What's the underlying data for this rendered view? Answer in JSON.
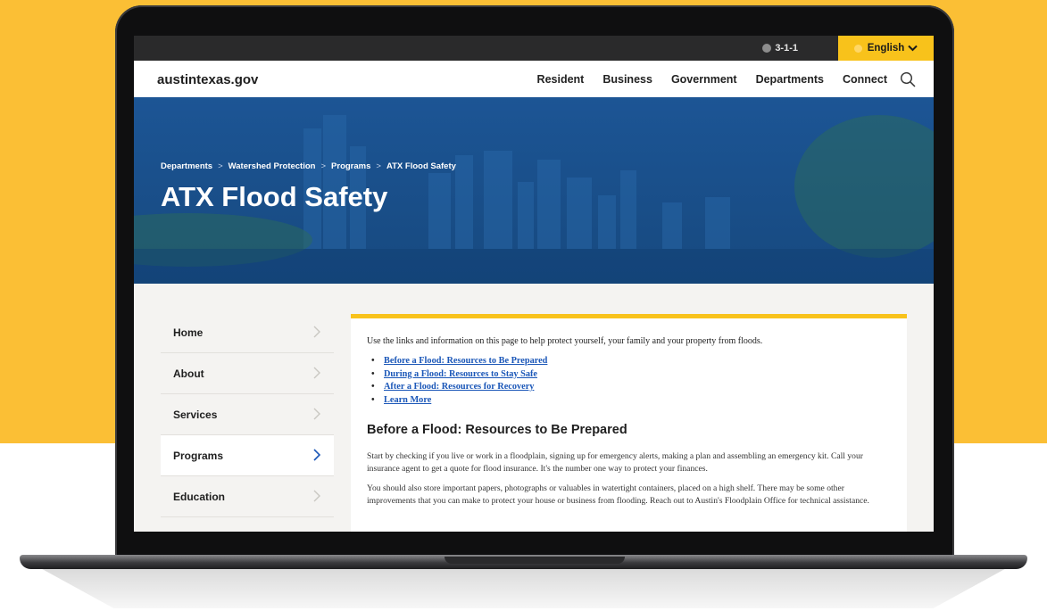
{
  "utility_bar": {
    "phone_label": "3-1-1",
    "language_label": "English"
  },
  "main_nav": {
    "logo": "austintexas.gov",
    "items": [
      "Resident",
      "Business",
      "Government",
      "Departments",
      "Connect"
    ]
  },
  "hero": {
    "breadcrumb": [
      "Departments",
      "Watershed Protection",
      "Programs",
      "ATX Flood Safety"
    ],
    "breadcrumb_separator": ">",
    "title": "ATX Flood Safety"
  },
  "sidebar": {
    "items": [
      "Home",
      "About",
      "Services",
      "Programs",
      "Education"
    ],
    "active_item": "Programs"
  },
  "content": {
    "intro": "Use the links and information on this page to help protect yourself, your family and your property from floods.",
    "links": [
      "Before a Flood: Resources to Be Prepared",
      "During a Flood: Resources to Stay Safe",
      "After a Flood: Resources for Recovery",
      "Learn More"
    ],
    "section_heading": "Before a Flood: Resources to Be Prepared",
    "paragraphs": [
      "Start by checking if you live or work in a floodplain, signing up for emergency alerts, making a plan and assembling an emergency kit. Call your insurance agent to get a quote for flood insurance. It's the number one way to protect your finances.",
      "You should also store important papers, photographs or valuables in watertight containers, placed on a high shelf. There may be some other improvements that you can make to protect your house or business from flooding. Reach out to Austin's Floodplain Office for technical assistance."
    ]
  },
  "colors": {
    "background_yellow": "#fbbf35",
    "accent_yellow": "#f8c21b",
    "hero_blue": "#1c5595",
    "link_blue": "#1b57b8"
  }
}
